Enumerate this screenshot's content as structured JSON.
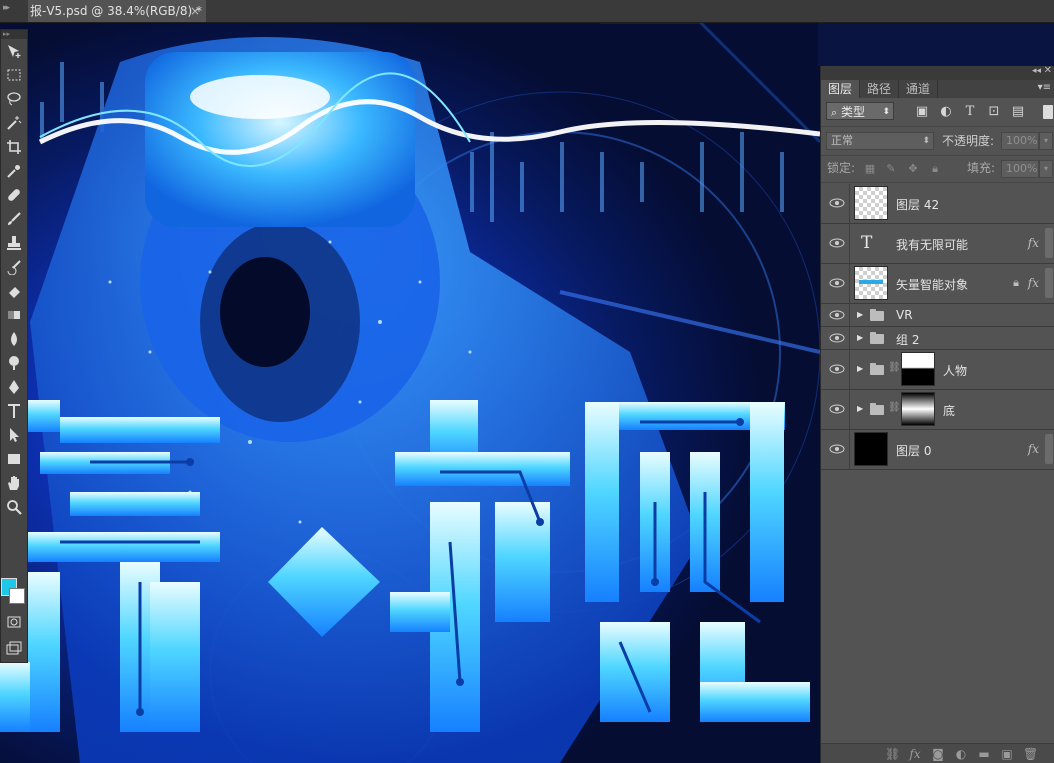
{
  "document_tab": {
    "title": "报-V5.psd @ 38.4%(RGB/8) *",
    "close": "×"
  },
  "tools": {
    "items": [
      "move-tool",
      "marquee-tool",
      "lasso-tool",
      "magic-wand-tool",
      "crop-tool",
      "eyedropper-tool",
      "healing-brush-tool",
      "brush-tool",
      "clone-stamp-tool",
      "history-brush-tool",
      "eraser-tool",
      "gradient-tool",
      "blur-tool",
      "dodge-tool",
      "pen-tool",
      "type-tool",
      "path-selection-tool",
      "shape-tool",
      "hand-tool",
      "zoom-tool"
    ],
    "foreground_color": "#1ec8e6",
    "background_color": "#ffffff"
  },
  "layers_panel": {
    "tabs": [
      "图层",
      "路径",
      "通道"
    ],
    "active_tab": "图层",
    "filter_kind": "类型",
    "blend_mode": "正常",
    "opacity_label": "不透明度:",
    "opacity_value": "100%",
    "lock_label": "锁定:",
    "fill_label": "填充:",
    "fill_value": "100%",
    "layers": [
      {
        "name": "图层 42",
        "type": "pixel",
        "fx": false
      },
      {
        "name": "我有无限可能",
        "type": "text",
        "fx": true,
        "thumb_glyph": "T"
      },
      {
        "name": "矢量智能对象",
        "type": "smart",
        "fx": true,
        "locked": true
      },
      {
        "name": "VR",
        "type": "group",
        "fx": false
      },
      {
        "name": "组 2",
        "type": "group",
        "fx": false
      },
      {
        "name": "人物",
        "type": "group-mask",
        "fx": false
      },
      {
        "name": "底",
        "type": "group-mask",
        "fx": false
      },
      {
        "name": "图层 0",
        "type": "pixel-black",
        "fx": true
      }
    ],
    "fx_label": "fx"
  },
  "accent_colors": {
    "canvas_deep": "#071a62",
    "canvas_mid": "#1a5cf0",
    "text_glow": "#5fe8ff"
  }
}
